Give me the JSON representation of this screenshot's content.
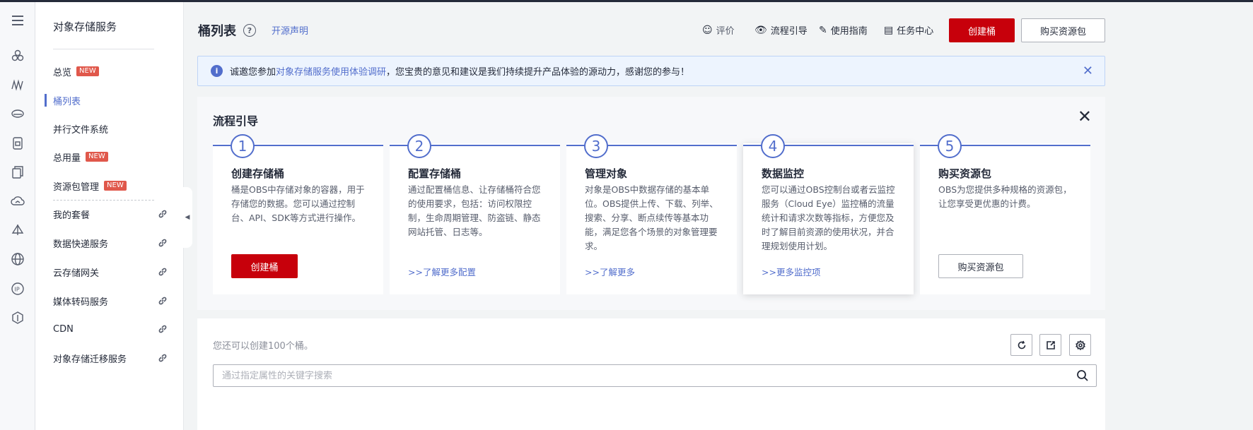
{
  "sidebar": {
    "title": "对象存储服务",
    "items": [
      {
        "label": "总览",
        "badge": "NEW"
      },
      {
        "label": "桶列表"
      },
      {
        "label": "并行文件系统"
      },
      {
        "label": "总用量",
        "badge": "NEW"
      },
      {
        "label": "资源包管理",
        "badge": "NEW"
      },
      {
        "label": "我的套餐"
      },
      {
        "label": "数据快递服务"
      },
      {
        "label": "云存储网关"
      },
      {
        "label": "媒体转码服务"
      },
      {
        "label": "CDN"
      },
      {
        "label": "对象存储迁移服务"
      }
    ]
  },
  "header": {
    "title": "桶列表",
    "help_icon": "?",
    "open_source_link": "开源声明",
    "links": {
      "rate": "评价",
      "flow_guide": "流程引导",
      "user_guide": "使用指南",
      "task_center": "任务中心"
    },
    "create_bucket": "创建桶",
    "buy_package": "购买资源包"
  },
  "banner": {
    "icon": "i",
    "prefix": "诚邀您参加",
    "link": "对象存储服务使用体验调研",
    "suffix": "，您宝贵的意见和建议是我们持续提升产品体验的源动力，感谢您的参与！"
  },
  "flow": {
    "title": "流程引导",
    "steps": [
      {
        "num": "1",
        "title": "创建存储桶",
        "desc": "桶是OBS中存储对象的容器，用于存储您的数据。您可以通过控制台、API、SDK等方式进行操作。",
        "button": "创建桶"
      },
      {
        "num": "2",
        "title": "配置存储桶",
        "desc": "通过配置桶信息、让存储桶符合您的使用要求，包括：访问权限控制，生命周期管理、防盗链、静态网站托管、日志等。",
        "link": ">>了解更多配置"
      },
      {
        "num": "3",
        "title": "管理对象",
        "desc": "对象是OBS中数据存储的基本单位。OBS提供上传、下载、列举、搜索、分享、断点续传等基本功能，满足您各个场景的对象管理要求。",
        "link": ">>了解更多"
      },
      {
        "num": "4",
        "title": "数据监控",
        "desc": "您可以通过OBS控制台或者云监控服务（Cloud Eye）监控桶的流量统计和请求次数等指标，方便您及时了解目前资源的使用状况，并合理规划使用计划。",
        "link": ">>更多监控项"
      },
      {
        "num": "5",
        "title": "购买资源包",
        "desc": "OBS为您提供多种规格的资源包，让您享受更优惠的计费。",
        "button": "购买资源包"
      }
    ]
  },
  "bucket": {
    "quota_text": "您还可以创建100个桶。",
    "search_placeholder": "通过指定属性的关键字搜索"
  },
  "colors": {
    "primary_red": "#c7000b",
    "link_blue": "#526ecc",
    "badge_red": "#e0584b"
  }
}
